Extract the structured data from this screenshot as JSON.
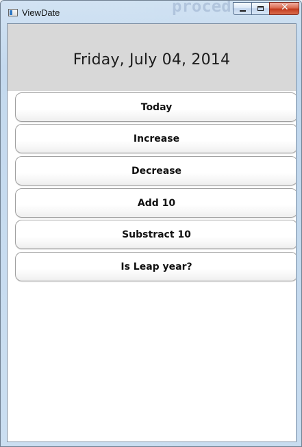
{
  "window": {
    "title": "ViewDate",
    "background_hint": "procedure"
  },
  "display": {
    "date": "Friday, July 04, 2014"
  },
  "buttons": [
    {
      "label": "Today"
    },
    {
      "label": "Increase"
    },
    {
      "label": "Decrease"
    },
    {
      "label": "Add 10"
    },
    {
      "label": "Substract 10"
    },
    {
      "label": "Is Leap year?"
    }
  ],
  "icons": {
    "app": "app-window-icon",
    "minimize": "minimize-icon",
    "maximize": "maximize-icon",
    "close": "close-icon"
  },
  "colors": {
    "date_panel": "#d8d8d8",
    "client_background": "#ffffff",
    "close_button": "#c23b1e"
  }
}
